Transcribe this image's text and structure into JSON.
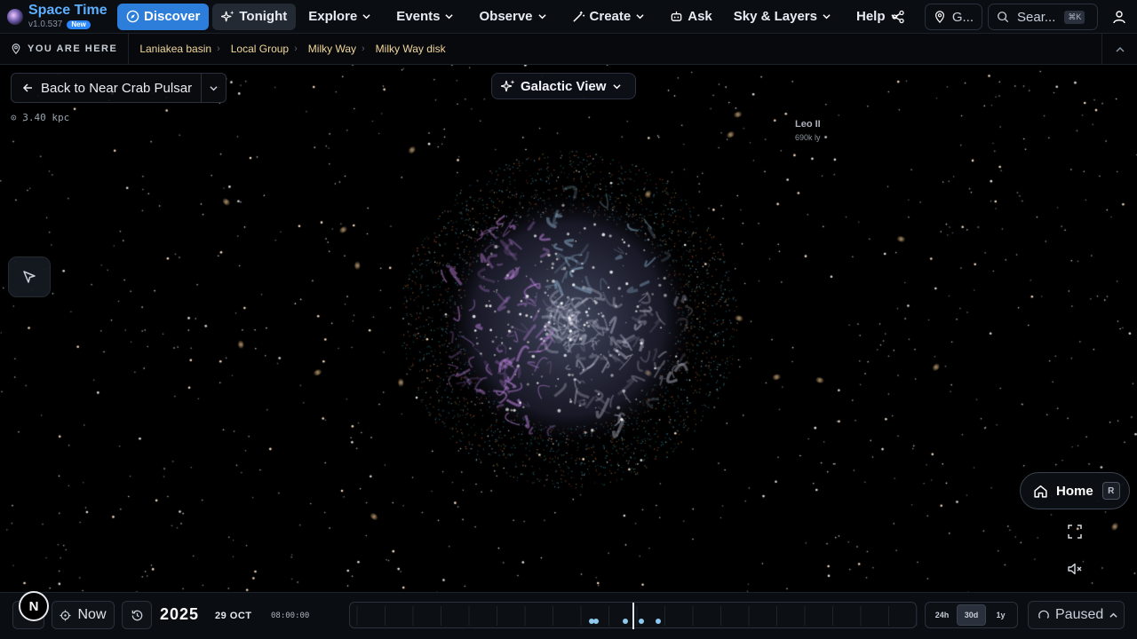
{
  "brand": {
    "name": "Space Time",
    "version": "v1.0.537",
    "badge": "New"
  },
  "nav": {
    "discover": "Discover",
    "tonight": "Tonight",
    "explore": "Explore",
    "events": "Events",
    "observe": "Observe",
    "create": "Create",
    "ask": "Ask",
    "sky_layers": "Sky & Layers",
    "help": "Help"
  },
  "top_right": {
    "location": "G...",
    "search_placeholder": "Sear...",
    "search_shortcut": "⌘K"
  },
  "breadcrumb": {
    "label": "YOU ARE HERE",
    "items": [
      "Laniakea basin",
      "Local Group",
      "Milky Way",
      "Milky Way disk"
    ],
    "separator": "›"
  },
  "back": {
    "label": "Back to Near Crab Pulsar"
  },
  "distance": "⊙ 3.40 kpc",
  "view_selector": {
    "label": "Galactic View"
  },
  "object_label": {
    "name": "Leo II",
    "distance": "690k ly"
  },
  "home": {
    "label": "Home",
    "shortcut": "R"
  },
  "compass": "N",
  "time": {
    "now_label": "Now",
    "year": "2025",
    "date": "29 OCT",
    "clock": "08:00:00",
    "ranges": [
      "24h",
      "30d",
      "1y"
    ],
    "active_range": "30d",
    "playback": "Paused"
  },
  "colors": {
    "accent": "#2d7ddb",
    "brand": "#5db0ff",
    "crumb": "#f1d79a"
  }
}
